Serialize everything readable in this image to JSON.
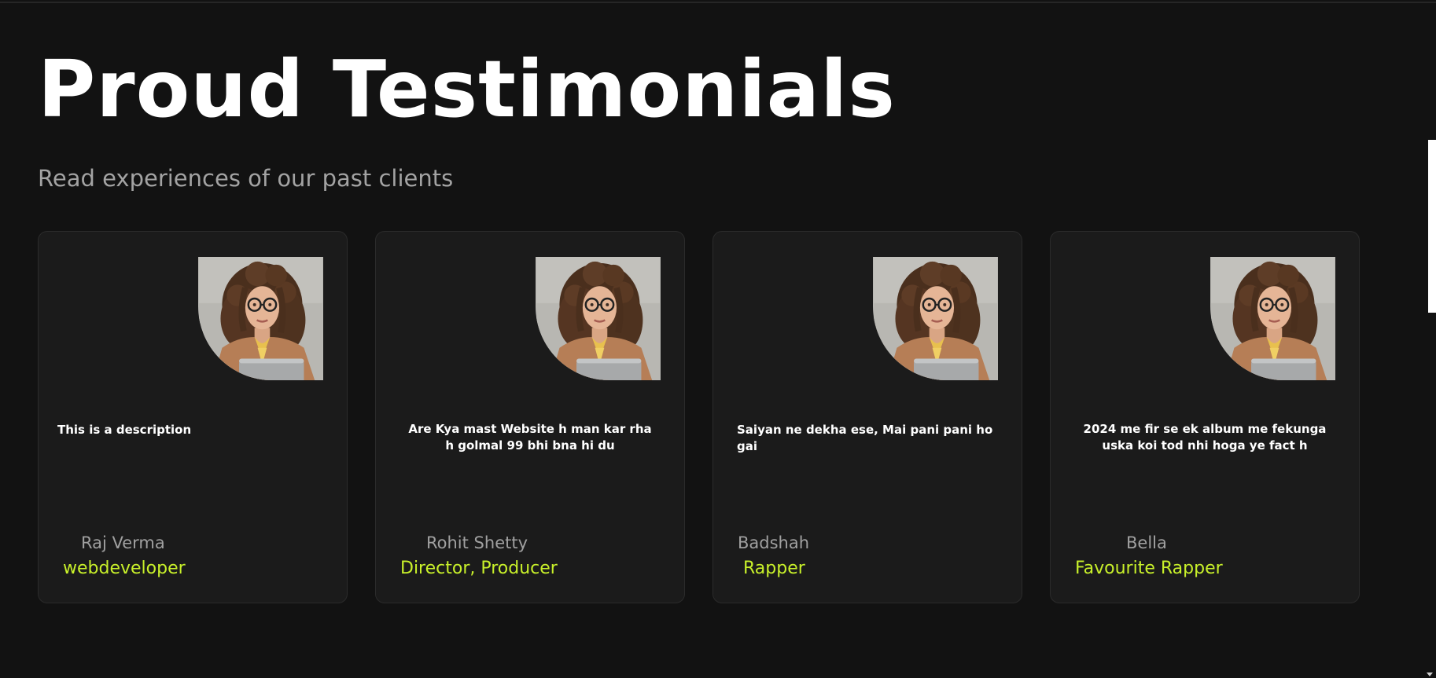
{
  "header": {
    "title": "Proud Testimonials",
    "subtitle": "Read experiences of our past clients"
  },
  "testimonials": [
    {
      "quote": "This is a description",
      "name": "Raj Verma",
      "role": "webdeveloper"
    },
    {
      "quote": "Are Kya mast Website h man kar rha h golmal 99 bhi bna hi du",
      "name": "Rohit Shetty",
      "role": "Director, Producer"
    },
    {
      "quote": "Saiyan ne dekha ese, Mai pani pani ho gai",
      "name": "Badshah",
      "role": "Rapper"
    },
    {
      "quote": "2024 me fir se ek album me fekunga uska koi tod nhi hoga ye fact h",
      "name": "Bella",
      "role": "Favourite Rapper"
    }
  ],
  "colors": {
    "background": "#121212",
    "card": "#1b1b1b",
    "accent": "#c8f02a",
    "muted_text": "#a0a0a0"
  },
  "icons": {
    "avatar": "woman-with-glasses-photo"
  }
}
